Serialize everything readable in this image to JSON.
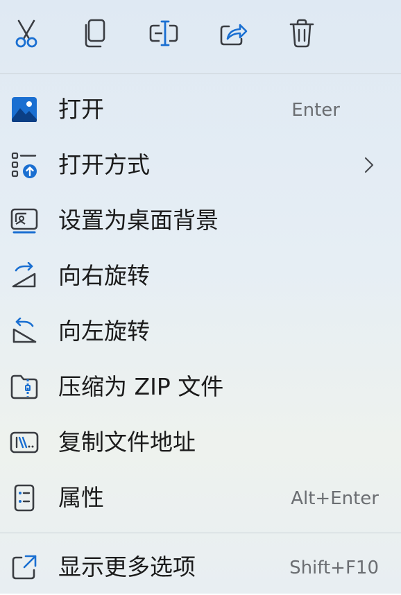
{
  "toolbar": {
    "items": [
      {
        "name": "cut",
        "icon": "scissors-icon"
      },
      {
        "name": "copy",
        "icon": "copy-icon"
      },
      {
        "name": "rename",
        "icon": "rename-icon"
      },
      {
        "name": "share",
        "icon": "share-icon"
      },
      {
        "name": "delete",
        "icon": "trash-icon"
      }
    ]
  },
  "menu": {
    "items": [
      {
        "label": "打开",
        "shortcut": "Enter",
        "icon": "image-icon"
      },
      {
        "label": "打开方式",
        "shortcut": "",
        "icon": "open-with-icon",
        "has_submenu": true
      },
      {
        "label": "设置为桌面背景",
        "shortcut": "",
        "icon": "wallpaper-icon"
      },
      {
        "label": "向右旋转",
        "shortcut": "",
        "icon": "rotate-right-icon"
      },
      {
        "label": "向左旋转",
        "shortcut": "",
        "icon": "rotate-left-icon"
      },
      {
        "label": "压缩为 ZIP 文件",
        "shortcut": "",
        "icon": "zip-folder-icon"
      },
      {
        "label": "复制文件地址",
        "shortcut": "",
        "icon": "copy-path-icon"
      },
      {
        "label": "属性",
        "shortcut": "Alt+Enter",
        "icon": "properties-icon"
      }
    ],
    "more": {
      "label": "显示更多选项",
      "shortcut": "Shift+F10",
      "icon": "more-options-icon"
    }
  },
  "colors": {
    "accent": "#1a6fd1",
    "icon_stroke": "#3a3d42",
    "text": "#1b1b1b",
    "shortcut_text": "#6b6e72"
  }
}
